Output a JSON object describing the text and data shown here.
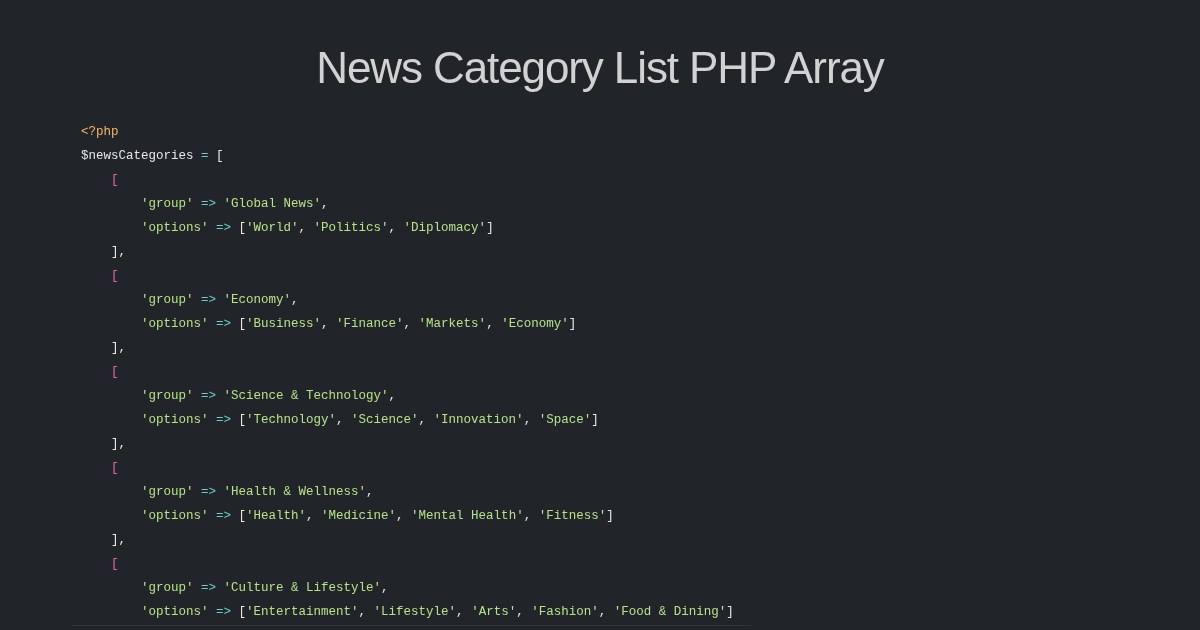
{
  "title": "News Category List PHP Array",
  "code_lines": [
    {
      "tokens": [
        {
          "kind": "tag",
          "text": "<?php"
        }
      ]
    },
    {
      "tokens": [
        {
          "kind": "var",
          "text": "$newsCategories"
        },
        {
          "kind": "op",
          "text": " = "
        },
        {
          "kind": "punct",
          "text": "["
        }
      ],
      "children": [
        {
          "tokens": [
            {
              "kind": "bracket",
              "text": "["
            }
          ],
          "children": [
            {
              "tokens": [
                {
                  "kind": "string",
                  "text": "'group'"
                },
                {
                  "kind": "op",
                  "text": " => "
                },
                {
                  "kind": "string",
                  "text": "'Global News'"
                },
                {
                  "kind": "punct",
                  "text": ","
                }
              ]
            },
            {
              "tokens": [
                {
                  "kind": "string",
                  "text": "'options'"
                },
                {
                  "kind": "op",
                  "text": " => "
                },
                {
                  "kind": "punct",
                  "text": "["
                },
                {
                  "kind": "string",
                  "text": "'World'"
                },
                {
                  "kind": "punct",
                  "text": ", "
                },
                {
                  "kind": "string",
                  "text": "'Politics'"
                },
                {
                  "kind": "punct",
                  "text": ", "
                },
                {
                  "kind": "string",
                  "text": "'Diplomacy'"
                },
                {
                  "kind": "punct",
                  "text": "]"
                }
              ]
            }
          ]
        },
        {
          "tokens": [
            {
              "kind": "punct",
              "text": "],"
            }
          ]
        },
        {
          "tokens": [
            {
              "kind": "bracket",
              "text": "["
            }
          ],
          "children": [
            {
              "tokens": [
                {
                  "kind": "string",
                  "text": "'group'"
                },
                {
                  "kind": "op",
                  "text": " => "
                },
                {
                  "kind": "string",
                  "text": "'Economy'"
                },
                {
                  "kind": "punct",
                  "text": ","
                }
              ]
            },
            {
              "tokens": [
                {
                  "kind": "string",
                  "text": "'options'"
                },
                {
                  "kind": "op",
                  "text": " => "
                },
                {
                  "kind": "punct",
                  "text": "["
                },
                {
                  "kind": "string",
                  "text": "'Business'"
                },
                {
                  "kind": "punct",
                  "text": ", "
                },
                {
                  "kind": "string",
                  "text": "'Finance'"
                },
                {
                  "kind": "punct",
                  "text": ", "
                },
                {
                  "kind": "string",
                  "text": "'Markets'"
                },
                {
                  "kind": "punct",
                  "text": ", "
                },
                {
                  "kind": "string",
                  "text": "'Economy'"
                },
                {
                  "kind": "punct",
                  "text": "]"
                }
              ]
            }
          ]
        },
        {
          "tokens": [
            {
              "kind": "punct",
              "text": "],"
            }
          ]
        },
        {
          "tokens": [
            {
              "kind": "bracket",
              "text": "["
            }
          ],
          "children": [
            {
              "tokens": [
                {
                  "kind": "string",
                  "text": "'group'"
                },
                {
                  "kind": "op",
                  "text": " => "
                },
                {
                  "kind": "string",
                  "text": "'Science & Technology'"
                },
                {
                  "kind": "punct",
                  "text": ","
                }
              ]
            },
            {
              "tokens": [
                {
                  "kind": "string",
                  "text": "'options'"
                },
                {
                  "kind": "op",
                  "text": " => "
                },
                {
                  "kind": "punct",
                  "text": "["
                },
                {
                  "kind": "string",
                  "text": "'Technology'"
                },
                {
                  "kind": "punct",
                  "text": ", "
                },
                {
                  "kind": "string",
                  "text": "'Science'"
                },
                {
                  "kind": "punct",
                  "text": ", "
                },
                {
                  "kind": "string",
                  "text": "'Innovation'"
                },
                {
                  "kind": "punct",
                  "text": ", "
                },
                {
                  "kind": "string",
                  "text": "'Space'"
                },
                {
                  "kind": "punct",
                  "text": "]"
                }
              ]
            }
          ]
        },
        {
          "tokens": [
            {
              "kind": "punct",
              "text": "],"
            }
          ]
        },
        {
          "tokens": [
            {
              "kind": "bracket",
              "text": "["
            }
          ],
          "children": [
            {
              "tokens": [
                {
                  "kind": "string",
                  "text": "'group'"
                },
                {
                  "kind": "op",
                  "text": " => "
                },
                {
                  "kind": "string",
                  "text": "'Health & Wellness'"
                },
                {
                  "kind": "punct",
                  "text": ","
                }
              ]
            },
            {
              "tokens": [
                {
                  "kind": "string",
                  "text": "'options'"
                },
                {
                  "kind": "op",
                  "text": " => "
                },
                {
                  "kind": "punct",
                  "text": "["
                },
                {
                  "kind": "string",
                  "text": "'Health'"
                },
                {
                  "kind": "punct",
                  "text": ", "
                },
                {
                  "kind": "string",
                  "text": "'Medicine'"
                },
                {
                  "kind": "punct",
                  "text": ", "
                },
                {
                  "kind": "string",
                  "text": "'Mental Health'"
                },
                {
                  "kind": "punct",
                  "text": ", "
                },
                {
                  "kind": "string",
                  "text": "'Fitness'"
                },
                {
                  "kind": "punct",
                  "text": "]"
                }
              ]
            }
          ]
        },
        {
          "tokens": [
            {
              "kind": "punct",
              "text": "],"
            }
          ]
        },
        {
          "tokens": [
            {
              "kind": "bracket",
              "text": "["
            }
          ],
          "children": [
            {
              "tokens": [
                {
                  "kind": "string",
                  "text": "'group'"
                },
                {
                  "kind": "op",
                  "text": " => "
                },
                {
                  "kind": "string",
                  "text": "'Culture & Lifestyle'"
                },
                {
                  "kind": "punct",
                  "text": ","
                }
              ]
            },
            {
              "tokens": [
                {
                  "kind": "string",
                  "text": "'options'"
                },
                {
                  "kind": "op",
                  "text": " => "
                },
                {
                  "kind": "punct",
                  "text": "["
                },
                {
                  "kind": "string",
                  "text": "'Entertainment'"
                },
                {
                  "kind": "punct",
                  "text": ", "
                },
                {
                  "kind": "string",
                  "text": "'Lifestyle'"
                },
                {
                  "kind": "punct",
                  "text": ", "
                },
                {
                  "kind": "string",
                  "text": "'Arts'"
                },
                {
                  "kind": "punct",
                  "text": ", "
                },
                {
                  "kind": "string",
                  "text": "'Fashion'"
                },
                {
                  "kind": "punct",
                  "text": ", "
                },
                {
                  "kind": "string",
                  "text": "'Food & Dining'"
                },
                {
                  "kind": "punct",
                  "text": "]"
                }
              ]
            }
          ]
        }
      ]
    }
  ]
}
